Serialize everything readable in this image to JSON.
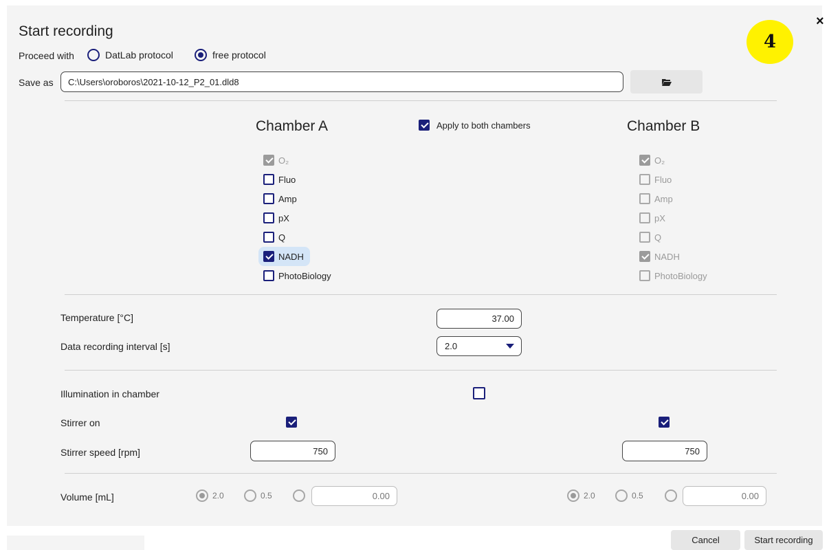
{
  "dialog": {
    "title": "Start recording",
    "close": "×",
    "badge": "4"
  },
  "proceed": {
    "label": "Proceed with",
    "options": [
      "DatLab protocol",
      "free protocol"
    ],
    "selected": "free protocol"
  },
  "save": {
    "label": "Save as",
    "value": "C:\\Users\\oroboros\\2021-10-12_P2_01.dld8",
    "folder_icon": "folder-open-icon"
  },
  "chambers": {
    "a_title": "Chamber A",
    "b_title": "Chamber B",
    "apply_both": "Apply to both chambers",
    "a": [
      {
        "label": "O₂",
        "checked": true,
        "disabled": true
      },
      {
        "label": "Fluo",
        "checked": false,
        "disabled": false
      },
      {
        "label": "Amp",
        "checked": false,
        "disabled": false
      },
      {
        "label": "pX",
        "checked": false,
        "disabled": false
      },
      {
        "label": "Q",
        "checked": false,
        "disabled": false
      },
      {
        "label": "NADH",
        "checked": true,
        "disabled": false
      },
      {
        "label": "PhotoBiology",
        "checked": false,
        "disabled": false
      }
    ],
    "b": [
      {
        "label": "O₂",
        "checked": true,
        "disabled": true
      },
      {
        "label": "Fluo",
        "checked": false,
        "disabled": true
      },
      {
        "label": "Amp",
        "checked": false,
        "disabled": true
      },
      {
        "label": "pX",
        "checked": false,
        "disabled": true
      },
      {
        "label": "Q",
        "checked": false,
        "disabled": true
      },
      {
        "label": "NADH",
        "checked": true,
        "disabled": true
      },
      {
        "label": "PhotoBiology",
        "checked": false,
        "disabled": true
      }
    ]
  },
  "settings": {
    "temperature_label": "Temperature [°C]",
    "temperature_value": "37.00",
    "interval_label": "Data recording interval [s]",
    "interval_value": "2.0",
    "illumination_label": "Illumination in chamber",
    "stirrer_on_label": "Stirrer on",
    "stirrer_speed_label": "Stirrer speed [rpm]",
    "stirrer_speed_a": "750",
    "stirrer_speed_b": "750",
    "volume_label": "Volume [mL]",
    "volume_opt1": "2.0",
    "volume_opt2": "0.5",
    "volume_custom_a": "0.00",
    "volume_custom_b": "0.00"
  },
  "footer": {
    "cancel": "Cancel",
    "start": "Start recording"
  },
  "colors": {
    "accent": "#1a1f7a",
    "highlight": "#d4e5f7",
    "badge": "#fff200"
  }
}
